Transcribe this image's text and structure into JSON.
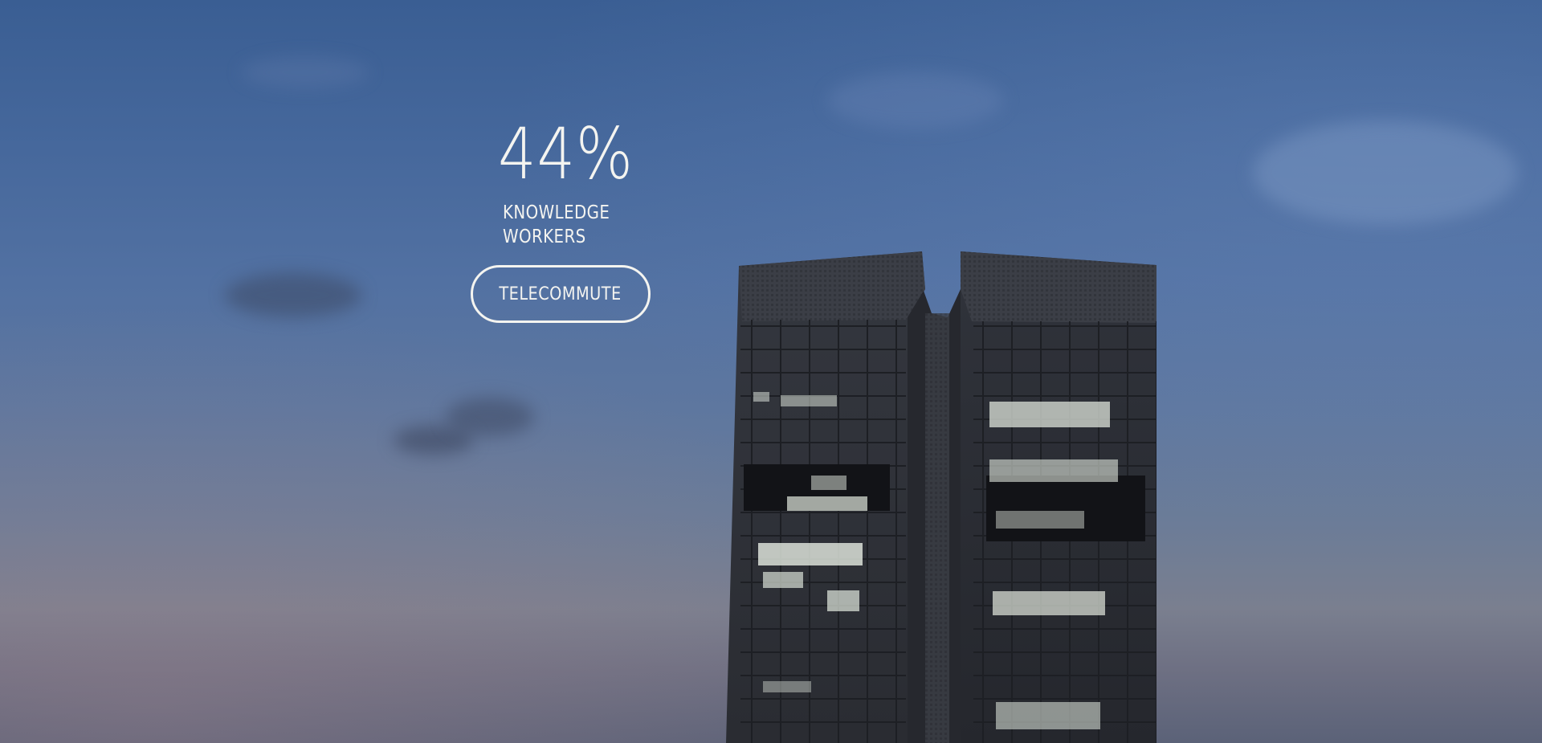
{
  "stat": {
    "value": "44%",
    "label_line1": "KNOWLEDGE",
    "label_line2": "WORKERS"
  },
  "cta": {
    "label": "TELECOMMUTE"
  },
  "colors": {
    "text": "#f4f4f0",
    "sky_top": "#3a5e93",
    "sky_bottom": "#5b6278",
    "building": "#2a2d34"
  }
}
